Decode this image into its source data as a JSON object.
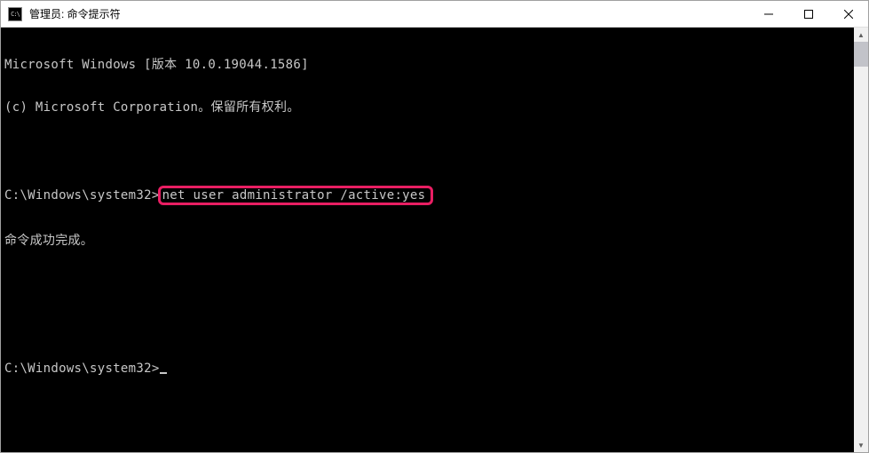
{
  "titlebar": {
    "icon_label": "C:\\",
    "title": "管理员: 命令提示符"
  },
  "terminal": {
    "line1": "Microsoft Windows [版本 10.0.19044.1586]",
    "line2": "(c) Microsoft Corporation。保留所有权利。",
    "prompt1_prefix": "C:\\Windows\\system32>",
    "command1": "net user administrator /active:yes",
    "result1": "命令成功完成。",
    "prompt2": "C:\\Windows\\system32>"
  }
}
